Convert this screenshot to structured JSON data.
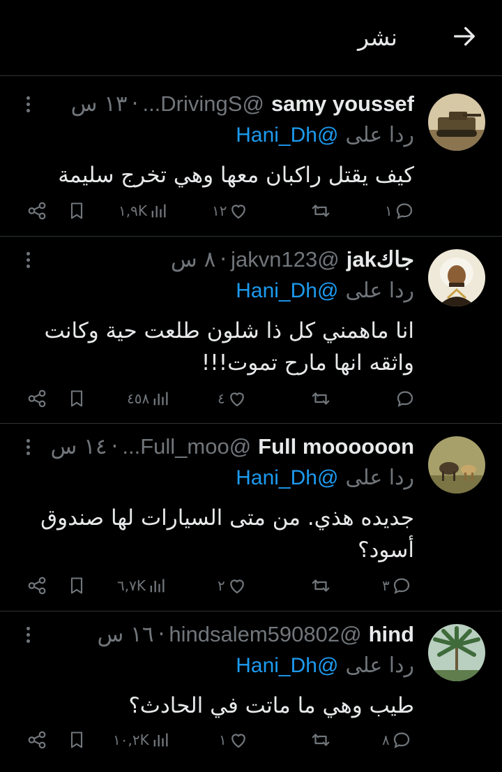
{
  "header": {
    "title": "نشر",
    "back_icon": "arrow-right-icon"
  },
  "reply_label": "ردا على",
  "tweets": [
    {
      "name": "samy youssef",
      "handle": "@DrivingS...",
      "time": "١٣ س",
      "reply_to": "@Hani_Dh",
      "text": "كيف يقتل راكبان معها وهي تخرج سليمة",
      "replies": "١",
      "retweets": "",
      "likes": "١٢",
      "views": "١,٩K",
      "avatar_colors": [
        "#d8c9a8",
        "#6b5a3a"
      ]
    },
    {
      "name": "جاكjak",
      "handle": "@jakvn123",
      "time": "٨ س",
      "reply_to": "@Hani_Dh",
      "text": "انا ماهمني كل ذا شلون طلعت حية وكانت واثقه انها مارح تموت!!!",
      "replies": "",
      "retweets": "",
      "likes": "٤",
      "views": "٤٥٨",
      "avatar_colors": [
        "#e8e2d2",
        "#7a5a2c"
      ]
    },
    {
      "name": "Full moooooon",
      "handle": "@Full_moo...",
      "time": "١٤ س",
      "reply_to": "@Hani_Dh",
      "text": "جديده هذي. من متى السيارات لها صندوق أسود؟",
      "replies": "٣",
      "retweets": "",
      "likes": "٢",
      "views": "٦,٧K",
      "avatar_colors": [
        "#b9b47a",
        "#5d4a2e"
      ]
    },
    {
      "name": "hind",
      "handle": "@hindsalem590802",
      "time": "١٦ س",
      "reply_to": "@Hani_Dh",
      "text": "طيب وهي ما ماتت في الحادث؟",
      "replies": "٨",
      "retweets": "",
      "likes": "١",
      "views": "١٠,٢K",
      "avatar_colors": [
        "#9fb6a4",
        "#3d5a35"
      ]
    }
  ],
  "colors": {
    "accent": "#1d9bf0",
    "muted": "#71767b",
    "text": "#e7e9ea",
    "border": "#2f3336"
  }
}
